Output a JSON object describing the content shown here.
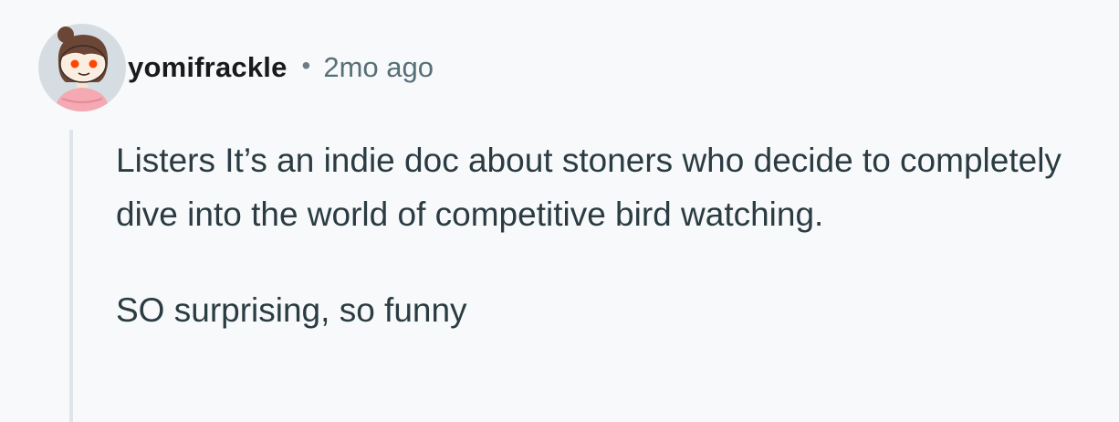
{
  "comment": {
    "author": "yomifrackle",
    "separator": "•",
    "timestamp": "2mo ago",
    "avatar_icon": "user-avatar-icon",
    "paragraphs": [
      "Listers It’s an indie doc about stoners who decide to completely dive into the world of competitive bird watching.",
      "SO surprising, so funny"
    ]
  },
  "colors": {
    "background": "#f8f9fb",
    "author": "#1a1a1b",
    "meta": "#576f76",
    "body_text": "#2a3c42",
    "thread_line": "#dfe5ea"
  }
}
